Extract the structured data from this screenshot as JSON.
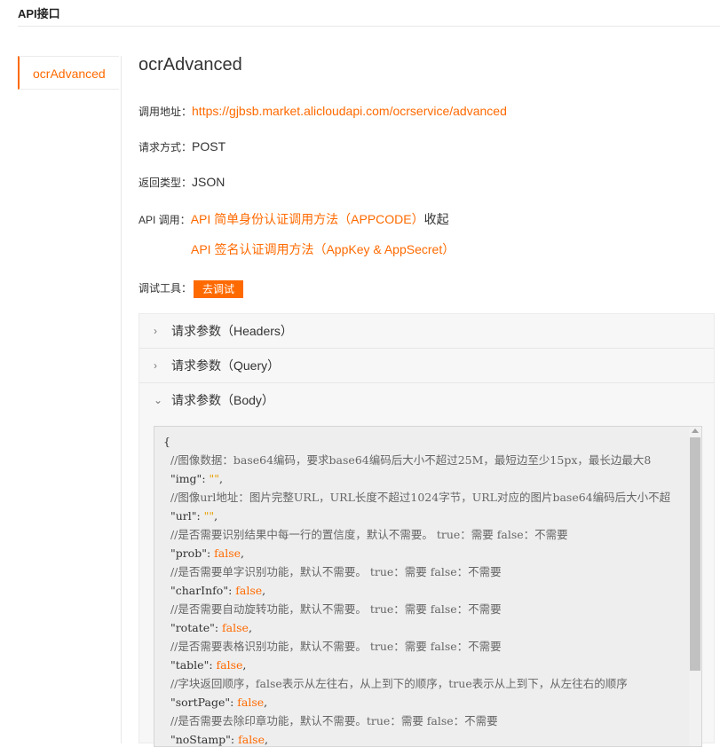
{
  "header": {
    "title": "API接口"
  },
  "sidebar": {
    "items": [
      {
        "label": "ocrAdvanced",
        "active": true
      }
    ]
  },
  "api": {
    "name": "ocrAdvanced",
    "url_label": "调用地址：",
    "url": "https://gjbsb.market.alicloudapi.com/ocrservice/advanced",
    "method_label": "请求方式：",
    "method": "POST",
    "return_label": "返回类型：",
    "return_type": "JSON",
    "invoke_label": "API 调用：",
    "invoke_link1": "API 简单身份认证调用方法（APPCODE）",
    "collapse": "收起",
    "invoke_link2": "API 签名认证调用方法（AppKey & AppSecret）",
    "debug_label": "调试工具：",
    "debug_button": "去调试"
  },
  "accordion": {
    "items": [
      {
        "label": "请求参数（Headers）",
        "expanded": false,
        "icon": "chevron-right"
      },
      {
        "label": "请求参数（Query）",
        "expanded": false,
        "icon": "chevron-right"
      },
      {
        "label": "请求参数（Body）",
        "expanded": true,
        "icon": "chevron-down"
      }
    ]
  },
  "body_code": {
    "open_brace": "{",
    "lines": [
      {
        "type": "comment",
        "text": "//图像数据：base64编码，要求base64编码后大小不超过25M，最短边至少15px，最长边最大8"
      },
      {
        "type": "field",
        "key": "\"img\"",
        "value": "\"\"",
        "value_type": "str"
      },
      {
        "type": "comment",
        "text": "//图像url地址：图片完整URL，URL长度不超过1024字节，URL对应的图片base64编码后大小不超"
      },
      {
        "type": "field",
        "key": "\"url\"",
        "value": "\"\"",
        "value_type": "str"
      },
      {
        "type": "comment",
        "text": "//是否需要识别结果中每一行的置信度，默认不需要。 true：需要 false：不需要"
      },
      {
        "type": "field",
        "key": "\"prob\"",
        "value": "false",
        "value_type": "bool"
      },
      {
        "type": "comment",
        "text": "//是否需要单字识别功能，默认不需要。 true：需要 false：不需要"
      },
      {
        "type": "field",
        "key": "\"charInfo\"",
        "value": "false",
        "value_type": "bool"
      },
      {
        "type": "comment",
        "text": "//是否需要自动旋转功能，默认不需要。 true：需要 false：不需要"
      },
      {
        "type": "field",
        "key": "\"rotate\"",
        "value": "false",
        "value_type": "bool"
      },
      {
        "type": "comment",
        "text": "//是否需要表格识别功能，默认不需要。 true：需要 false：不需要"
      },
      {
        "type": "field",
        "key": "\"table\"",
        "value": "false",
        "value_type": "bool"
      },
      {
        "type": "comment",
        "text": "//字块返回顺序，false表示从左往右，从上到下的顺序，true表示从上到下，从左往右的顺序"
      },
      {
        "type": "field",
        "key": "\"sortPage\"",
        "value": "false",
        "value_type": "bool"
      },
      {
        "type": "comment",
        "text": "//是否需要去除印章功能，默认不需要。true：需要 false：不需要"
      },
      {
        "type": "field",
        "key": "\"noStamp\"",
        "value": "false",
        "value_type": "bool"
      }
    ]
  },
  "colors": {
    "accent": "#ff6a00",
    "string": "#e8a000"
  }
}
